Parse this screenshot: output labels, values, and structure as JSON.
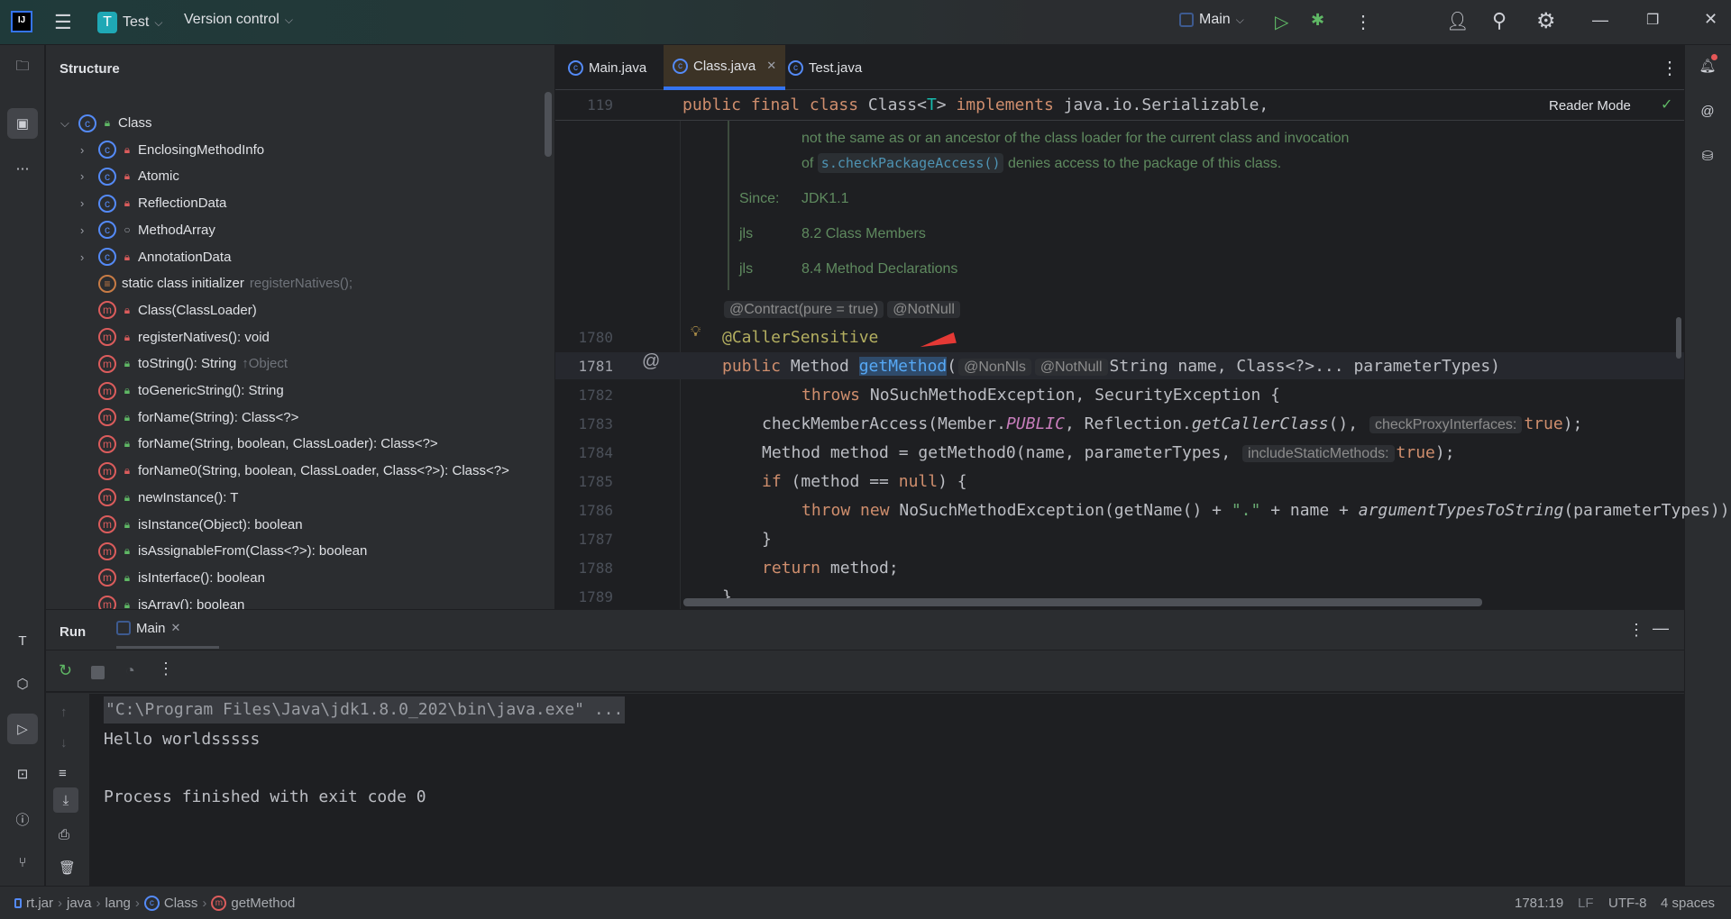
{
  "titlebar": {
    "project_initial": "T",
    "project_name": "Test",
    "vcs": "Version control",
    "run_config": "Main"
  },
  "structure": {
    "title": "Structure",
    "items": [
      {
        "label": "Class",
        "hint": "",
        "kind": "class",
        "vis": "public",
        "expand": "open",
        "level": 0
      },
      {
        "label": "EnclosingMethodInfo",
        "hint": "",
        "kind": "class",
        "vis": "private",
        "expand": "closed",
        "level": 1
      },
      {
        "label": "Atomic",
        "hint": "",
        "kind": "class",
        "vis": "private",
        "expand": "closed",
        "level": 1
      },
      {
        "label": "ReflectionData",
        "hint": "",
        "kind": "class",
        "vis": "private",
        "expand": "closed",
        "level": 1
      },
      {
        "label": "MethodArray",
        "hint": "",
        "kind": "class",
        "vis": "package",
        "expand": "closed",
        "level": 1
      },
      {
        "label": "AnnotationData",
        "hint": "",
        "kind": "class",
        "vis": "private",
        "expand": "closed",
        "level": 1
      },
      {
        "label": "static class initializer",
        "hint": "registerNatives();",
        "kind": "static",
        "vis": "",
        "expand": "",
        "level": 1
      },
      {
        "label": "Class(ClassLoader)",
        "hint": "",
        "kind": "method",
        "vis": "private",
        "expand": "",
        "level": 1
      },
      {
        "label": "registerNatives(): void",
        "hint": "",
        "kind": "method",
        "vis": "private",
        "expand": "",
        "level": 1
      },
      {
        "label": "toString(): String",
        "hint": "↑Object",
        "kind": "method",
        "vis": "public",
        "expand": "",
        "level": 1
      },
      {
        "label": "toGenericString(): String",
        "hint": "",
        "kind": "method",
        "vis": "public",
        "expand": "",
        "level": 1
      },
      {
        "label": "forName(String): Class<?>",
        "hint": "",
        "kind": "method",
        "vis": "public",
        "expand": "",
        "level": 1
      },
      {
        "label": "forName(String, boolean, ClassLoader): Class<?>",
        "hint": "",
        "kind": "method",
        "vis": "public",
        "expand": "",
        "level": 1
      },
      {
        "label": "forName0(String, boolean, ClassLoader, Class<?>): Class<?>",
        "hint": "",
        "kind": "method",
        "vis": "private",
        "expand": "",
        "level": 1
      },
      {
        "label": "newInstance(): T",
        "hint": "",
        "kind": "method",
        "vis": "public",
        "expand": "",
        "level": 1
      },
      {
        "label": "isInstance(Object): boolean",
        "hint": "",
        "kind": "method",
        "vis": "public",
        "expand": "",
        "level": 1
      },
      {
        "label": "isAssignableFrom(Class<?>): boolean",
        "hint": "",
        "kind": "method",
        "vis": "public",
        "expand": "",
        "level": 1
      },
      {
        "label": "isInterface(): boolean",
        "hint": "",
        "kind": "method",
        "vis": "public",
        "expand": "",
        "level": 1
      },
      {
        "label": "isArray(): boolean",
        "hint": "",
        "kind": "method",
        "vis": "public",
        "expand": "",
        "level": 1
      }
    ]
  },
  "editor": {
    "tabs": [
      {
        "label": "Main.java",
        "active": false
      },
      {
        "label": "Class.java",
        "active": true
      },
      {
        "label": "Test.java",
        "active": false
      }
    ],
    "sticky": {
      "line": "119",
      "tokens": [
        {
          "t": "public final class ",
          "c": "kw"
        },
        {
          "t": "Class<",
          "c": ""
        },
        {
          "t": "T",
          "c": "tp"
        },
        {
          "t": "> ",
          "c": ""
        },
        {
          "t": "implements ",
          "c": "kw"
        },
        {
          "t": "java.io.Serializable,",
          "c": ""
        }
      ]
    },
    "reader_mode": "Reader Mode",
    "doc": {
      "line1": "not the same as or an ancestor of the class loader for the current class and invocation",
      "line2_pre": "of",
      "line2_code": "s.checkPackageAccess()",
      "line2_post": "denies access to the package of this class.",
      "since_label": "Since:",
      "since_value": "JDK1.1",
      "jls": [
        {
          "label": "jls",
          "value": "8.2 Class Members"
        },
        {
          "label": "jls",
          "value": "8.4 Method Declarations"
        }
      ]
    },
    "inferred_annotations": [
      "@Contract(pure = true)",
      "@NotNull"
    ],
    "lines": [
      {
        "n": "1780",
        "indent": 0,
        "tokens": [
          {
            "t": "@CallerSensitive",
            "c": "an"
          }
        ]
      },
      {
        "n": "1781",
        "indent": 0,
        "current": true,
        "tokens": [
          {
            "t": "public ",
            "c": "kw"
          },
          {
            "t": "Method ",
            "c": ""
          },
          {
            "t": "getMethod",
            "c": "fn sel"
          },
          {
            "t": "(",
            "c": ""
          },
          {
            "t": "@NonNls",
            "c": "hint"
          },
          {
            "t": "@NotNull",
            "c": "hint"
          },
          {
            "t": "String name, Class<?>... parameterTypes)",
            "c": ""
          }
        ]
      },
      {
        "n": "1782",
        "indent": 2,
        "tokens": [
          {
            "t": "throws ",
            "c": "kw"
          },
          {
            "t": "NoSuchMethodException, SecurityException {",
            "c": ""
          }
        ]
      },
      {
        "n": "1783",
        "indent": 1,
        "tokens": [
          {
            "t": "checkMemberAccess(Member.",
            "c": ""
          },
          {
            "t": "PUBLIC",
            "c": "pu"
          },
          {
            "t": ", Reflection.",
            "c": ""
          },
          {
            "t": "getCallerClass",
            "c": "it"
          },
          {
            "t": "(), ",
            "c": ""
          },
          {
            "t": "checkProxyInterfaces:",
            "c": "hint"
          },
          {
            "t": "true",
            "c": "kw"
          },
          {
            "t": ");",
            "c": ""
          }
        ]
      },
      {
        "n": "1784",
        "indent": 1,
        "tokens": [
          {
            "t": "Method method = getMethod0(name, parameterTypes, ",
            "c": ""
          },
          {
            "t": "includeStaticMethods:",
            "c": "hint"
          },
          {
            "t": "true",
            "c": "kw"
          },
          {
            "t": ");",
            "c": ""
          }
        ]
      },
      {
        "n": "1785",
        "indent": 1,
        "tokens": [
          {
            "t": "if ",
            "c": "kw"
          },
          {
            "t": "(method == ",
            "c": ""
          },
          {
            "t": "null",
            "c": "kw"
          },
          {
            "t": ") {",
            "c": ""
          }
        ]
      },
      {
        "n": "1786",
        "indent": 2,
        "tokens": [
          {
            "t": "throw new ",
            "c": "kw"
          },
          {
            "t": "NoSuchMethodException(getName() + ",
            "c": ""
          },
          {
            "t": "\".\"",
            "c": "st"
          },
          {
            "t": " + name + ",
            "c": ""
          },
          {
            "t": "argumentTypesToString",
            "c": "it"
          },
          {
            "t": "(parameterTypes));",
            "c": ""
          }
        ]
      },
      {
        "n": "1787",
        "indent": 1,
        "tokens": [
          {
            "t": "}",
            "c": ""
          }
        ]
      },
      {
        "n": "1788",
        "indent": 1,
        "tokens": [
          {
            "t": "return ",
            "c": "kw"
          },
          {
            "t": "method;",
            "c": ""
          }
        ]
      },
      {
        "n": "1789",
        "indent": 0,
        "tokens": [
          {
            "t": "}",
            "c": ""
          }
        ]
      }
    ]
  },
  "run": {
    "title": "Run",
    "tab": "Main",
    "console": [
      "\"C:\\Program Files\\Java\\jdk1.8.0_202\\bin\\java.exe\" ...",
      "Hello worldsssss",
      "",
      "Process finished with exit code 0"
    ]
  },
  "statusbar": {
    "breadcrumb": [
      "rt.jar",
      "java",
      "lang",
      "Class",
      "getMethod"
    ],
    "position": "1781:19",
    "line_sep": "LF",
    "encoding": "UTF-8",
    "indent": "4 spaces"
  },
  "colors": {
    "accent": "#3574f0",
    "keyword": "#cf8e6d",
    "annotation": "#b3ae60",
    "function": "#56a8f5",
    "run": "#5fb865",
    "error_arrow": "#e53935"
  }
}
